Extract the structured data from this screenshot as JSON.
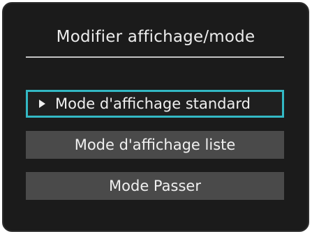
{
  "menu": {
    "title": "Modifier affichage/mode",
    "items": [
      {
        "label": "Mode d'affichage standard",
        "selected": true
      },
      {
        "label": "Mode d'affichage liste",
        "selected": false
      },
      {
        "label": "Mode Passer",
        "selected": false
      }
    ],
    "selection_marker_icon": "triangle-right-icon"
  },
  "colors": {
    "background": "#1b1b1b",
    "item_background": "#4a4a4a",
    "selection_border": "#33b8c4",
    "text": "#f0f0f0"
  }
}
